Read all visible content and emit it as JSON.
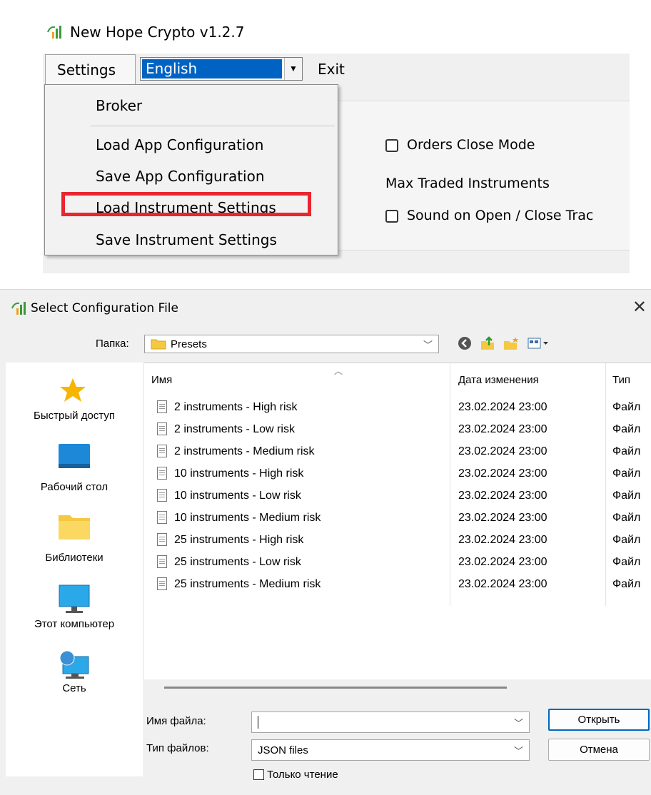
{
  "app": {
    "title": "New Hope Crypto v1.2.7",
    "menu": {
      "settings": "Settings",
      "language": "English",
      "exit": "Exit"
    },
    "dropdown_items": [
      "Broker",
      "Load App Configuration",
      "Save App Configuration",
      "Load Instrument Settings",
      "Save Instrument Settings"
    ],
    "highlighted_item": "Load Instrument Settings",
    "panel": {
      "orders_close_mode": "Orders Close Mode",
      "max_traded": "Max Traded Instruments",
      "sound": "Sound on Open / Close Trac"
    },
    "colors": {
      "highlight_border": "#e8262f",
      "selection": "#0063c4"
    }
  },
  "dialog": {
    "title": "Select Configuration File",
    "folder_label": "Папка:",
    "folder_value": "Presets",
    "places": [
      "Быстрый доступ",
      "Рабочий стол",
      "Библиотеки",
      "Этот компьютер",
      "Сеть"
    ],
    "columns": {
      "name": "Имя",
      "date": "Дата изменения",
      "type": "Тип"
    },
    "files": [
      {
        "name": "2 instruments - High risk",
        "date": "23.02.2024 23:00",
        "type": "Файл"
      },
      {
        "name": "2 instruments - Low risk",
        "date": "23.02.2024 23:00",
        "type": "Файл"
      },
      {
        "name": "2 instruments - Medium risk",
        "date": "23.02.2024 23:00",
        "type": "Файл"
      },
      {
        "name": "10 instruments - High risk",
        "date": "23.02.2024 23:00",
        "type": "Файл"
      },
      {
        "name": "10 instruments - Low risk",
        "date": "23.02.2024 23:00",
        "type": "Файл"
      },
      {
        "name": "10 instruments - Medium risk",
        "date": "23.02.2024 23:00",
        "type": "Файл"
      },
      {
        "name": "25 instruments - High risk",
        "date": "23.02.2024 23:00",
        "type": "Файл"
      },
      {
        "name": "25 instruments - Low risk",
        "date": "23.02.2024 23:00",
        "type": "Файл"
      },
      {
        "name": "25 instruments - Medium risk",
        "date": "23.02.2024 23:00",
        "type": "Файл"
      }
    ],
    "filename_label": "Имя файла:",
    "filename_value": "",
    "filetype_label": "Тип файлов:",
    "filetype_value": "JSON files",
    "readonly_label": "Только чтение",
    "open_button": "Открыть",
    "cancel_button": "Отмена"
  }
}
